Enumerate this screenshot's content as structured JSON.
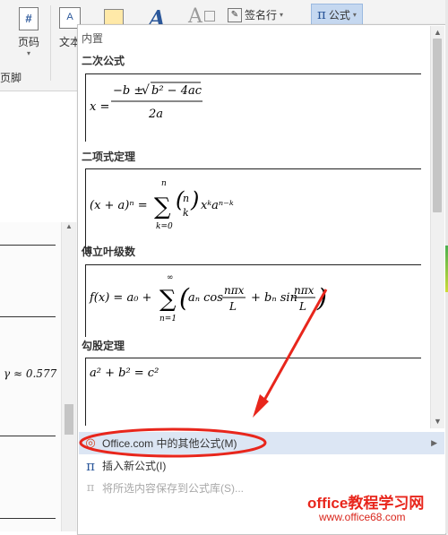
{
  "ribbon": {
    "page_number_label": "页码",
    "textbox_label": "文本",
    "signature_line_label": "签名行",
    "equation_label": "公式",
    "footer_group_label": "页脚",
    "page_number_icon": "#"
  },
  "dropdown": {
    "builtin_header": "内置",
    "equations": [
      {
        "name": "二次公式"
      },
      {
        "name": "二项式定理"
      },
      {
        "name": "傅立叶级数"
      },
      {
        "name": "勾股定理"
      }
    ],
    "menu": {
      "more_equations": "Office.com 中的其他公式(M)",
      "insert_new": "插入新公式(I)",
      "save_selection": "将所选内容保存到公式库(S)..."
    }
  },
  "doc": {
    "partial_formula": "γ ≈ 0.577"
  },
  "watermark": {
    "line1": "office教程学习网",
    "line2": "www.office68.com"
  },
  "colors": {
    "accent": "#2b579a",
    "highlight": "#dce6f4",
    "annotation_red": "#e8261c"
  }
}
